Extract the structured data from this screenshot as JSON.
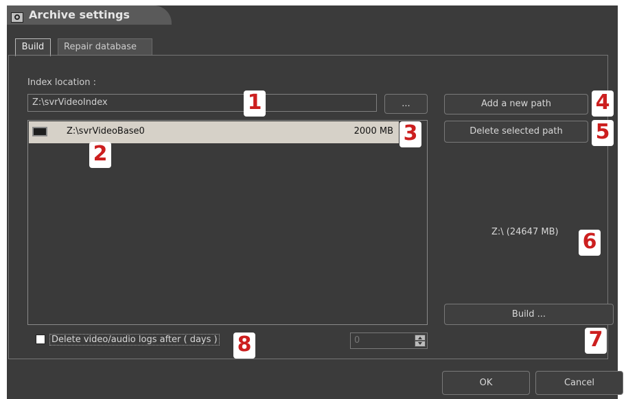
{
  "window": {
    "title": "Archive settings",
    "icon": "archive-settings-icon"
  },
  "tabs": [
    {
      "label": "Build",
      "active": true
    },
    {
      "label": "Repair database",
      "active": false
    }
  ],
  "index_location": {
    "label": "Index location :",
    "value": "Z:\\svrVideoIndex",
    "browse_label": "..."
  },
  "paths_list": [
    {
      "icon": "drive-icon",
      "path": "Z:\\svrVideoBase0",
      "size": "2000 MB",
      "selected": true
    }
  ],
  "buttons": {
    "add_path": "Add a new path",
    "delete_path": "Delete selected path",
    "build": "Build ...",
    "ok": "OK",
    "cancel": "Cancel"
  },
  "disk_info": "Z:\\  (24647 MB)",
  "delete_logs": {
    "label": "Delete video/audio logs after ( days )",
    "checked": false,
    "days_value": "0"
  },
  "annotations": [
    "1",
    "2",
    "3",
    "4",
    "5",
    "6",
    "7",
    "8"
  ]
}
